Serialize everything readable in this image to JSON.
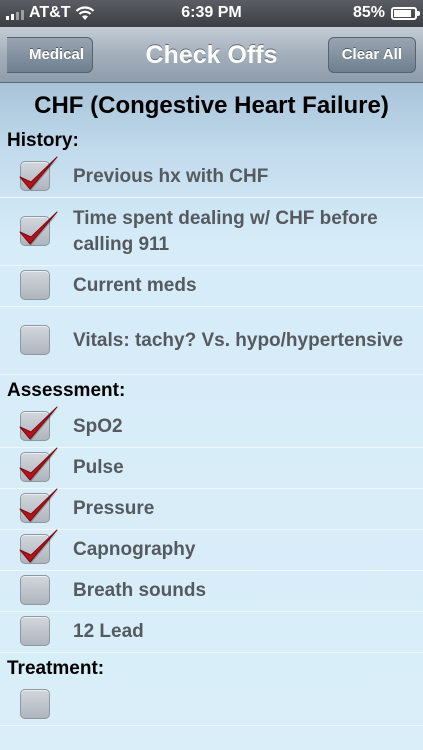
{
  "status_bar": {
    "carrier": "AT&T",
    "time": "6:39 PM",
    "battery": "85%",
    "battery_level": 0.85
  },
  "nav": {
    "back_label": "Medical",
    "title": "Check Offs",
    "clear_label": "Clear All"
  },
  "page_title": "CHF (Congestive Heart Failure)",
  "sections": [
    {
      "header": "History:",
      "items": [
        {
          "label": "Previous hx with CHF",
          "checked": true
        },
        {
          "label": "Time spent dealing w/ CHF before calling 911",
          "checked": true
        },
        {
          "label": "Current meds",
          "checked": false
        },
        {
          "label": "Vitals: tachy? Vs. hypo/hypertensive",
          "checked": false
        }
      ]
    },
    {
      "header": "Assessment:",
      "items": [
        {
          "label": "SpO2",
          "checked": true
        },
        {
          "label": "Pulse",
          "checked": true
        },
        {
          "label": "Pressure",
          "checked": true
        },
        {
          "label": "Capnography",
          "checked": true
        },
        {
          "label": "Breath sounds",
          "checked": false
        },
        {
          "label": "12 Lead",
          "checked": false
        }
      ]
    },
    {
      "header": "Treatment:",
      "items": [
        {
          "label": "",
          "checked": false
        }
      ]
    }
  ],
  "colors": {
    "checkmark": "#b5121b",
    "label_text": "#555a5f",
    "background": "#d6ecf8"
  },
  "icons": {
    "signal": "signal-bars-icon",
    "wifi": "wifi-icon",
    "battery": "battery-charging-icon",
    "check": "checkmark-icon"
  }
}
